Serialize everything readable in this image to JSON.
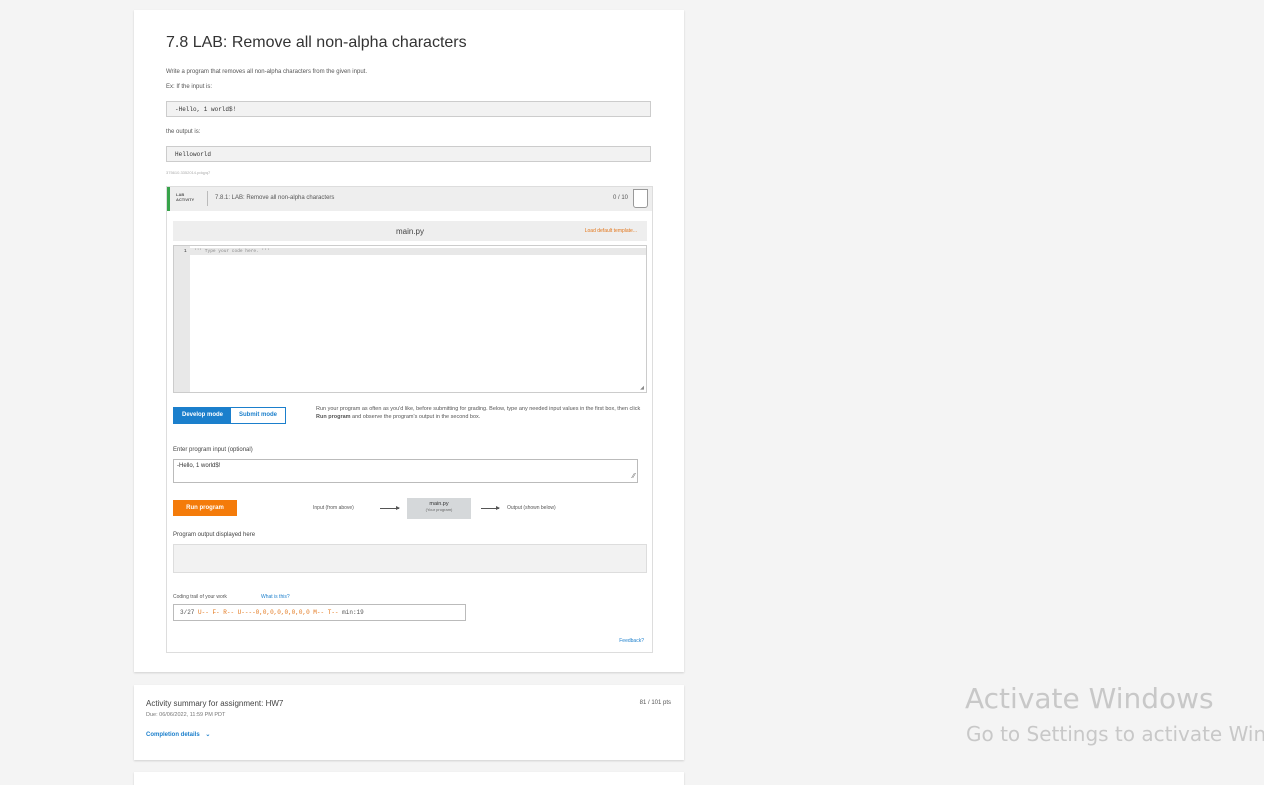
{
  "lab": {
    "title": "7.8 LAB: Remove all non-alpha characters",
    "prompt": "Write a program that removes all non-alpha characters from the given input.",
    "example_intro": "Ex: If the input is:",
    "example_input": "-Hello, 1 world$!",
    "output_intro": "the output is:",
    "example_output": "Helloworld",
    "code_id": "375610.3352014.pdqyq7"
  },
  "activity": {
    "badge_line1": "LAB",
    "badge_line2": "ACTIVITY",
    "name": "7.8.1: LAB: Remove all non-alpha characters",
    "score": "0 / 10",
    "file_name": "main.py",
    "load_template": "Load default template...",
    "line_number": "1",
    "code_line": "''' Type your code here. '''",
    "develop_mode": "Develop mode",
    "submit_mode": "Submit mode",
    "mode_desc_1": "Run your program as often as you'd like, before submitting for grading. Below, type any needed input values in the first box, then click ",
    "mode_desc_bold": "Run program",
    "mode_desc_2": " and observe the program's output in the second box.",
    "input_label": "Enter program input (optional)",
    "input_value": "-Hello, 1 world$!",
    "run_button": "Run program",
    "flow_input": "Input (from above)",
    "flow_main": "main.py",
    "flow_main_sub": "(Your program)",
    "flow_output": "Output (shown below)",
    "output_label": "Program output displayed here",
    "trail_label": "Coding trail of your work",
    "trail_link": "What is this?",
    "trail": {
      "date": "3/27",
      "u1": "U--",
      "f": "F-",
      "r": "R--",
      "u2": "U----0,0,0,0,0,0,0,0",
      "m": "M--",
      "t": "T--",
      "min": "min:19"
    },
    "feedback": "Feedback?"
  },
  "summary": {
    "title": "Activity summary for assignment: HW7",
    "due": "Due: 06/06/2022, 11:59 PM PDT",
    "points": "81 / 101 pts",
    "completion": "Completion details"
  },
  "watermark": {
    "line1": "Activate Windows",
    "line2": "Go to Settings to activate Windows."
  }
}
